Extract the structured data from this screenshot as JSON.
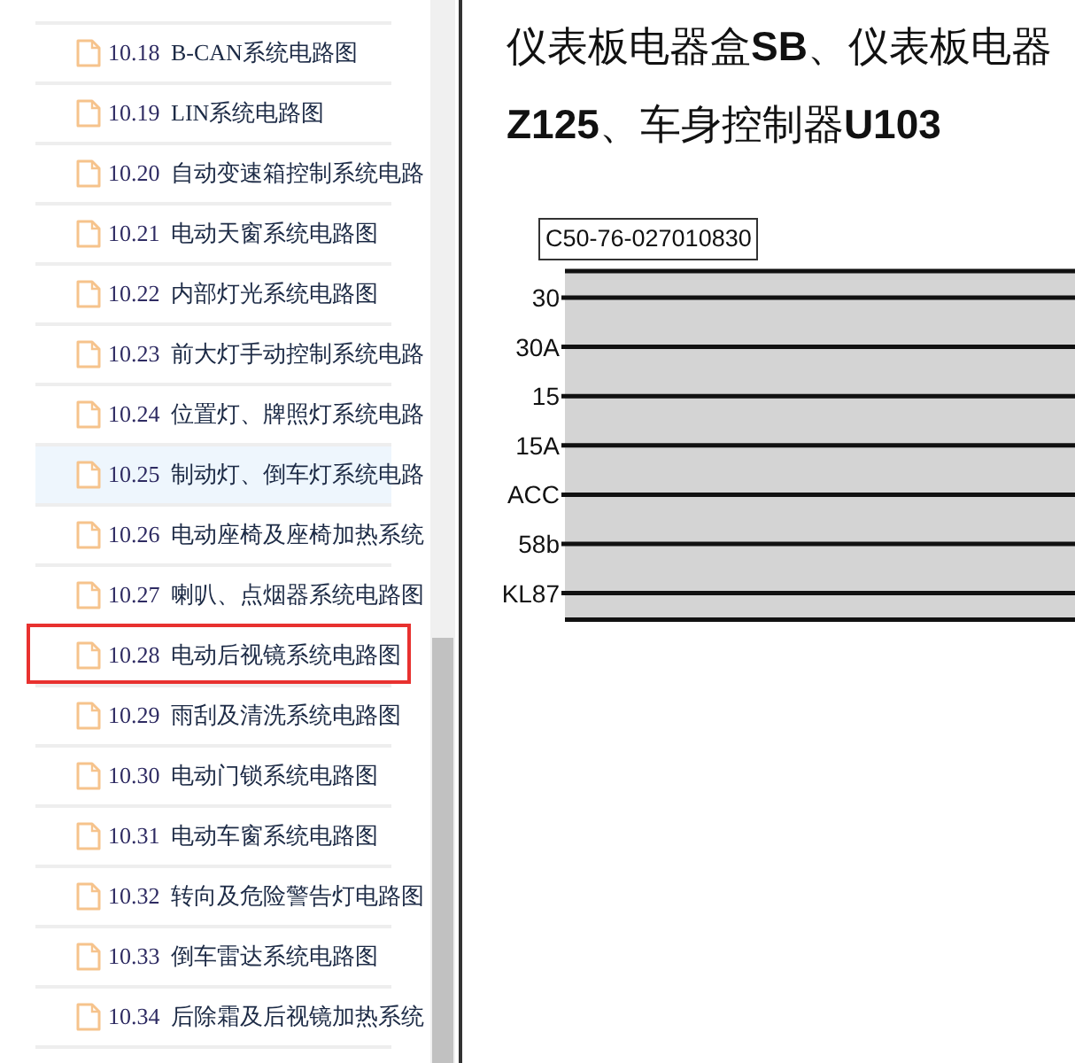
{
  "sidebar": {
    "items": [
      {
        "number": "10.18",
        "title": "B-CAN系统电路图",
        "selected": false,
        "annotated": false
      },
      {
        "number": "10.19",
        "title": "LIN系统电路图",
        "selected": false,
        "annotated": false
      },
      {
        "number": "10.20",
        "title": "自动变速箱控制系统电路",
        "selected": false,
        "annotated": false
      },
      {
        "number": "10.21",
        "title": "电动天窗系统电路图",
        "selected": false,
        "annotated": false
      },
      {
        "number": "10.22",
        "title": "内部灯光系统电路图",
        "selected": false,
        "annotated": false
      },
      {
        "number": "10.23",
        "title": "前大灯手动控制系统电路",
        "selected": false,
        "annotated": false
      },
      {
        "number": "10.24",
        "title": "位置灯、牌照灯系统电路",
        "selected": false,
        "annotated": false
      },
      {
        "number": "10.25",
        "title": "制动灯、倒车灯系统电路",
        "selected": true,
        "annotated": false
      },
      {
        "number": "10.26",
        "title": "电动座椅及座椅加热系统",
        "selected": false,
        "annotated": false
      },
      {
        "number": "10.27",
        "title": "喇叭、点烟器系统电路图",
        "selected": false,
        "annotated": false
      },
      {
        "number": "10.28",
        "title": "电动后视镜系统电路图",
        "selected": false,
        "annotated": true
      },
      {
        "number": "10.29",
        "title": "雨刮及清洗系统电路图",
        "selected": false,
        "annotated": false
      },
      {
        "number": "10.30",
        "title": "电动门锁系统电路图",
        "selected": false,
        "annotated": false
      },
      {
        "number": "10.31",
        "title": "电动车窗系统电路图",
        "selected": false,
        "annotated": false
      },
      {
        "number": "10.32",
        "title": "转向及危险警告灯电路图",
        "selected": false,
        "annotated": false
      },
      {
        "number": "10.33",
        "title": "倒车雷达系统电路图",
        "selected": false,
        "annotated": false
      },
      {
        "number": "10.34",
        "title": "后除霜及后视镜加热系统",
        "selected": false,
        "annotated": false
      }
    ]
  },
  "document": {
    "title_lines": [
      "仪表板电器盒**SB**、仪表板电器",
      "**Z125**、车身控制器**U103**"
    ],
    "diagram": {
      "connector": "C50-76-027010830",
      "pins": [
        "30",
        "30A",
        "15",
        "15A",
        "ACC",
        "58b",
        "KL87"
      ]
    }
  }
}
